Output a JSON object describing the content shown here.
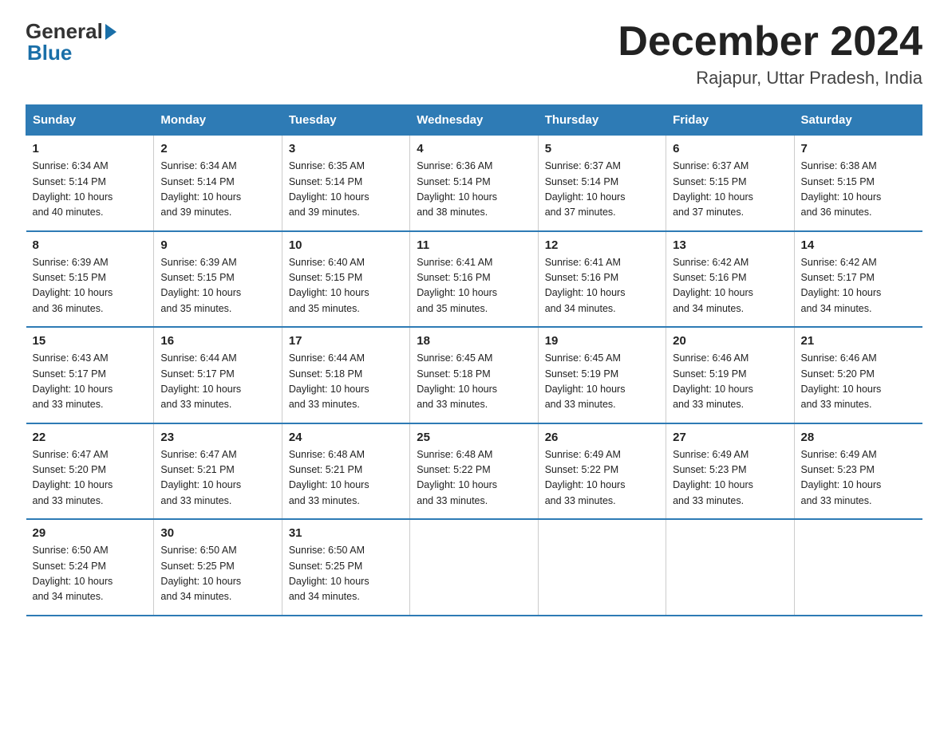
{
  "logo": {
    "general": "General",
    "blue": "Blue"
  },
  "title": "December 2024",
  "subtitle": "Rajapur, Uttar Pradesh, India",
  "days_of_week": [
    "Sunday",
    "Monday",
    "Tuesday",
    "Wednesday",
    "Thursday",
    "Friday",
    "Saturday"
  ],
  "weeks": [
    [
      {
        "day": "1",
        "sunrise": "6:34 AM",
        "sunset": "5:14 PM",
        "daylight": "10 hours and 40 minutes."
      },
      {
        "day": "2",
        "sunrise": "6:34 AM",
        "sunset": "5:14 PM",
        "daylight": "10 hours and 39 minutes."
      },
      {
        "day": "3",
        "sunrise": "6:35 AM",
        "sunset": "5:14 PM",
        "daylight": "10 hours and 39 minutes."
      },
      {
        "day": "4",
        "sunrise": "6:36 AM",
        "sunset": "5:14 PM",
        "daylight": "10 hours and 38 minutes."
      },
      {
        "day": "5",
        "sunrise": "6:37 AM",
        "sunset": "5:14 PM",
        "daylight": "10 hours and 37 minutes."
      },
      {
        "day": "6",
        "sunrise": "6:37 AM",
        "sunset": "5:15 PM",
        "daylight": "10 hours and 37 minutes."
      },
      {
        "day": "7",
        "sunrise": "6:38 AM",
        "sunset": "5:15 PM",
        "daylight": "10 hours and 36 minutes."
      }
    ],
    [
      {
        "day": "8",
        "sunrise": "6:39 AM",
        "sunset": "5:15 PM",
        "daylight": "10 hours and 36 minutes."
      },
      {
        "day": "9",
        "sunrise": "6:39 AM",
        "sunset": "5:15 PM",
        "daylight": "10 hours and 35 minutes."
      },
      {
        "day": "10",
        "sunrise": "6:40 AM",
        "sunset": "5:15 PM",
        "daylight": "10 hours and 35 minutes."
      },
      {
        "day": "11",
        "sunrise": "6:41 AM",
        "sunset": "5:16 PM",
        "daylight": "10 hours and 35 minutes."
      },
      {
        "day": "12",
        "sunrise": "6:41 AM",
        "sunset": "5:16 PM",
        "daylight": "10 hours and 34 minutes."
      },
      {
        "day": "13",
        "sunrise": "6:42 AM",
        "sunset": "5:16 PM",
        "daylight": "10 hours and 34 minutes."
      },
      {
        "day": "14",
        "sunrise": "6:42 AM",
        "sunset": "5:17 PM",
        "daylight": "10 hours and 34 minutes."
      }
    ],
    [
      {
        "day": "15",
        "sunrise": "6:43 AM",
        "sunset": "5:17 PM",
        "daylight": "10 hours and 33 minutes."
      },
      {
        "day": "16",
        "sunrise": "6:44 AM",
        "sunset": "5:17 PM",
        "daylight": "10 hours and 33 minutes."
      },
      {
        "day": "17",
        "sunrise": "6:44 AM",
        "sunset": "5:18 PM",
        "daylight": "10 hours and 33 minutes."
      },
      {
        "day": "18",
        "sunrise": "6:45 AM",
        "sunset": "5:18 PM",
        "daylight": "10 hours and 33 minutes."
      },
      {
        "day": "19",
        "sunrise": "6:45 AM",
        "sunset": "5:19 PM",
        "daylight": "10 hours and 33 minutes."
      },
      {
        "day": "20",
        "sunrise": "6:46 AM",
        "sunset": "5:19 PM",
        "daylight": "10 hours and 33 minutes."
      },
      {
        "day": "21",
        "sunrise": "6:46 AM",
        "sunset": "5:20 PM",
        "daylight": "10 hours and 33 minutes."
      }
    ],
    [
      {
        "day": "22",
        "sunrise": "6:47 AM",
        "sunset": "5:20 PM",
        "daylight": "10 hours and 33 minutes."
      },
      {
        "day": "23",
        "sunrise": "6:47 AM",
        "sunset": "5:21 PM",
        "daylight": "10 hours and 33 minutes."
      },
      {
        "day": "24",
        "sunrise": "6:48 AM",
        "sunset": "5:21 PM",
        "daylight": "10 hours and 33 minutes."
      },
      {
        "day": "25",
        "sunrise": "6:48 AM",
        "sunset": "5:22 PM",
        "daylight": "10 hours and 33 minutes."
      },
      {
        "day": "26",
        "sunrise": "6:49 AM",
        "sunset": "5:22 PM",
        "daylight": "10 hours and 33 minutes."
      },
      {
        "day": "27",
        "sunrise": "6:49 AM",
        "sunset": "5:23 PM",
        "daylight": "10 hours and 33 minutes."
      },
      {
        "day": "28",
        "sunrise": "6:49 AM",
        "sunset": "5:23 PM",
        "daylight": "10 hours and 33 minutes."
      }
    ],
    [
      {
        "day": "29",
        "sunrise": "6:50 AM",
        "sunset": "5:24 PM",
        "daylight": "10 hours and 34 minutes."
      },
      {
        "day": "30",
        "sunrise": "6:50 AM",
        "sunset": "5:25 PM",
        "daylight": "10 hours and 34 minutes."
      },
      {
        "day": "31",
        "sunrise": "6:50 AM",
        "sunset": "5:25 PM",
        "daylight": "10 hours and 34 minutes."
      },
      null,
      null,
      null,
      null
    ]
  ],
  "labels": {
    "sunrise": "Sunrise:",
    "sunset": "Sunset:",
    "daylight": "Daylight:"
  }
}
